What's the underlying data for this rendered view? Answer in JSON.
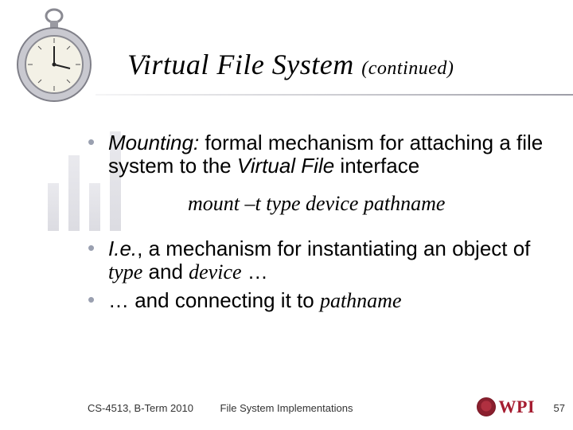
{
  "title": {
    "main": "Virtual File System",
    "cont": "(continued)"
  },
  "bullets": {
    "b1_prefix_italic": "Mounting:",
    "b1_rest_a": " formal mechanism for attaching a file system to the ",
    "b1_rest_italic": "Virtual File",
    "b1_rest_b": " interface",
    "cmd": "mount –t type device pathname",
    "b2_prefix_italic": "I.e.",
    "b2_mid": ", a mechanism for instantiating an object of ",
    "b2_type": "type",
    "b2_and": " and ",
    "b2_device": "device",
    "b2_tail": " …",
    "b3_lead": "… and connecting it to ",
    "b3_path": "pathname"
  },
  "footer": {
    "left": "CS-4513, B-Term 2010",
    "center": "File System Implementations",
    "logo_text": "WPI",
    "page": "57"
  },
  "icons": {
    "watch": "pocket-watch-icon",
    "seal": "wpi-seal-icon"
  }
}
